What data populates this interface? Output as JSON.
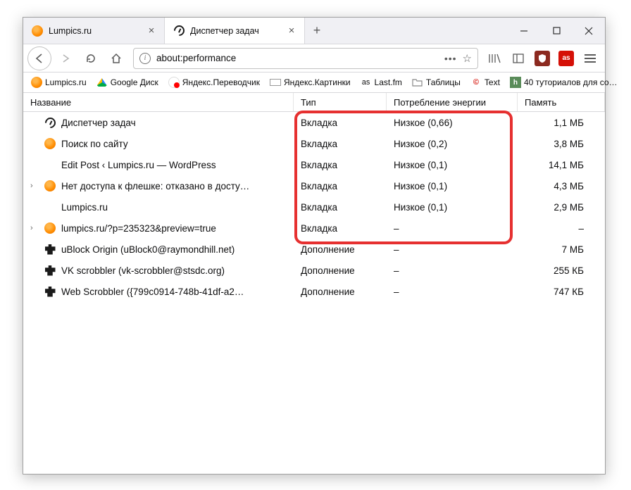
{
  "tabs": [
    {
      "label": "Lumpics.ru",
      "active": false
    },
    {
      "label": "Диспетчер задач",
      "active": true
    }
  ],
  "url": "about:performance",
  "bookmarks": [
    {
      "label": "Lumpics.ru",
      "icon": "orange"
    },
    {
      "label": "Google Диск",
      "icon": "gdrive"
    },
    {
      "label": "Яндекс.Переводчик",
      "icon": "yap"
    },
    {
      "label": "Яндекс.Картинки",
      "icon": "ytx"
    },
    {
      "label": "Last.fm",
      "icon": "last"
    },
    {
      "label": "Таблицы",
      "icon": "folder"
    },
    {
      "label": "Text",
      "icon": "ctext"
    },
    {
      "label": "40 туториалов для со…",
      "icon": "htut"
    }
  ],
  "columns": {
    "name": "Название",
    "type": "Тип",
    "energy": "Потребление энергии",
    "memory": "Память"
  },
  "rows": [
    {
      "expand": "",
      "icon": "gauge",
      "name": "Диспетчер задач",
      "type": "Вкладка",
      "energy": "Низкое (0,66)",
      "memory": "1,1 МБ"
    },
    {
      "expand": "",
      "icon": "orange",
      "name": "Поиск по сайту",
      "type": "Вкладка",
      "energy": "Низкое (0,2)",
      "memory": "3,8 МБ"
    },
    {
      "expand": "",
      "icon": "none",
      "name": "Edit Post ‹ Lumpics.ru — WordPress",
      "type": "Вкладка",
      "energy": "Низкое (0,1)",
      "memory": "14,1 МБ"
    },
    {
      "expand": "›",
      "icon": "orange",
      "name": "Нет доступа к флешке: отказано в досту…",
      "type": "Вкладка",
      "energy": "Низкое (0,1)",
      "memory": "4,3 МБ"
    },
    {
      "expand": "",
      "icon": "none",
      "name": "Lumpics.ru",
      "type": "Вкладка",
      "energy": "Низкое (0,1)",
      "memory": "2,9 МБ"
    },
    {
      "expand": "›",
      "icon": "orange",
      "name": "lumpics.ru/?p=235323&preview=true",
      "type": "Вкладка",
      "energy": "–",
      "memory": "–"
    },
    {
      "expand": "",
      "icon": "puzzle",
      "name": "uBlock Origin (uBlock0@raymondhill.net)",
      "type": "Дополнение",
      "energy": "–",
      "memory": "7 МБ"
    },
    {
      "expand": "",
      "icon": "puzzle",
      "name": "VK scrobbler (vk-scrobbler@stsdc.org)",
      "type": "Дополнение",
      "energy": "–",
      "memory": "255 КБ"
    },
    {
      "expand": "",
      "icon": "puzzle",
      "name": "Web Scrobbler ({799c0914-748b-41df-a2…",
      "type": "Дополнение",
      "energy": "–",
      "memory": "747 КБ"
    }
  ]
}
